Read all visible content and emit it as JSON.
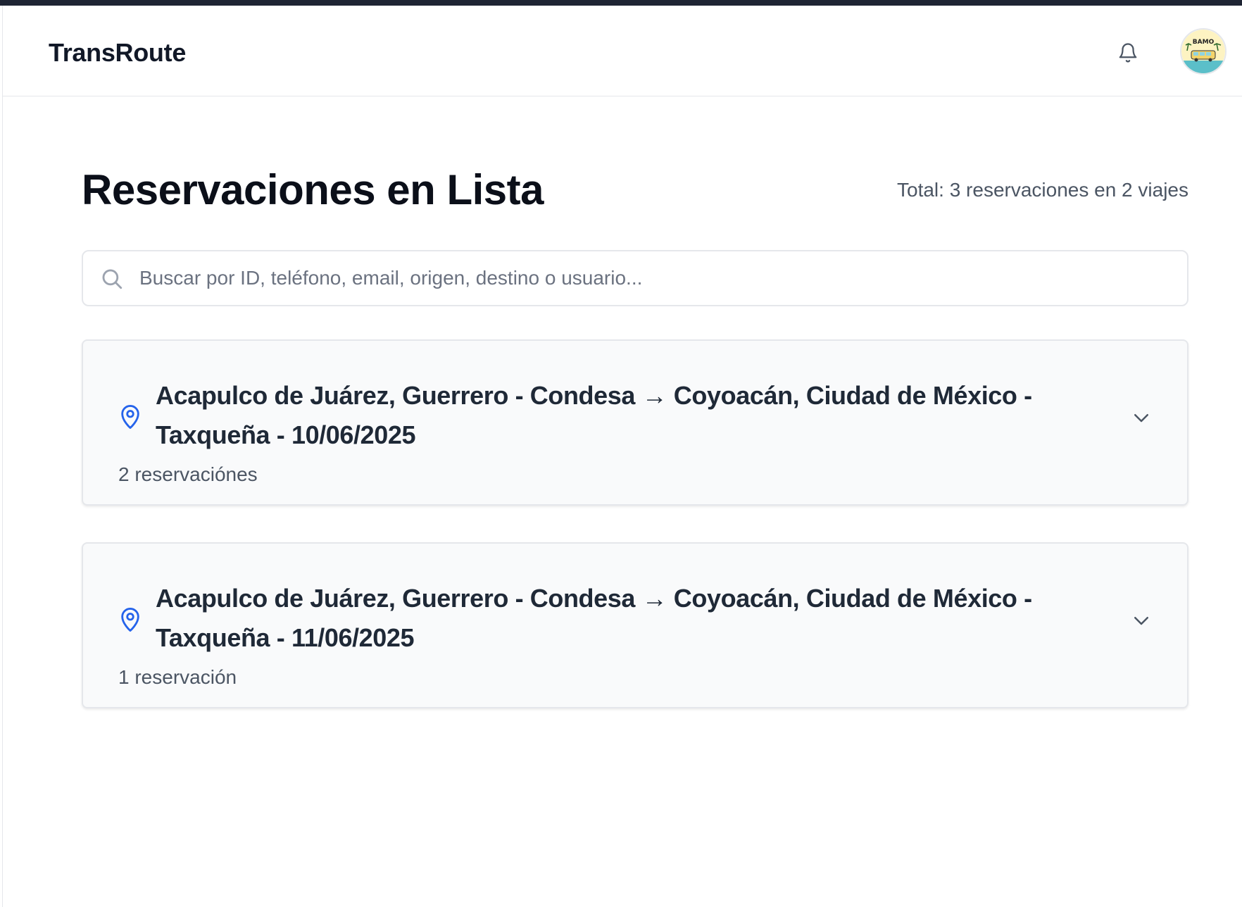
{
  "app": {
    "brand": "TransRoute"
  },
  "header": {
    "notifications_icon": "bell-icon",
    "avatar_icon": "user-avatar",
    "avatar_text": "BAMO"
  },
  "page": {
    "title": "Reservaciones en Lista",
    "total": "Total: 3 reservaciones en 2 viajes"
  },
  "search": {
    "placeholder": "Buscar por ID, teléfono, email, origen, destino o usuario...",
    "value": ""
  },
  "trips": [
    {
      "title": "Acapulco de Juárez, Guerrero - Condesa → Coyoacán, Ciudad de México - Taxqueña - 10/06/2025",
      "count": "2 reservaciónes"
    },
    {
      "title": "Acapulco de Juárez, Guerrero - Condesa → Coyoacán, Ciudad de México - Taxqueña - 11/06/2025",
      "count": "1 reservación"
    }
  ],
  "colors": {
    "accent_blue": "#2563eb",
    "top_stripe": "#1e2433",
    "card_bg": "#f9fafb",
    "border": "#e5e7eb"
  }
}
